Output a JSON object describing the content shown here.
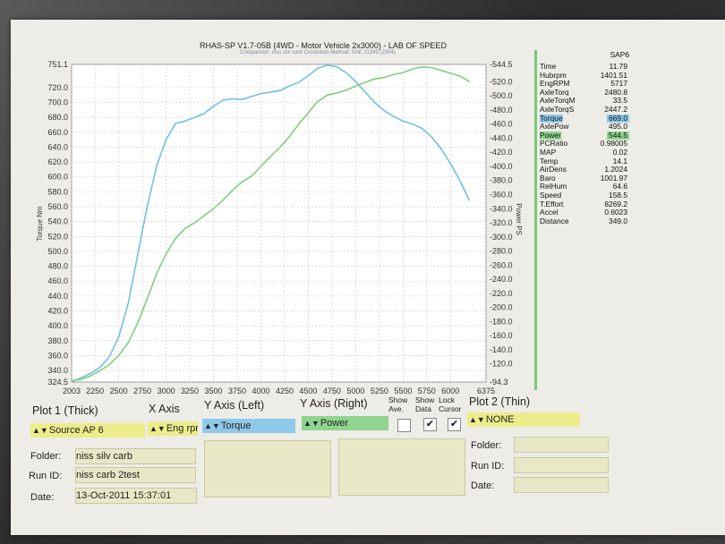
{
  "report": {
    "title": "RHAS-SP V1.7-05B  (4WD - Motor Vehicle 2x3000) - LAB OF SPEED",
    "subtitle": "Comparison: niss silv carb    Correction-Method: SAE J1349 (2004)"
  },
  "colors": {
    "torque": "#6fc0e4",
    "power": "#7fcf7f",
    "field_yellow": "#ecec8a"
  },
  "chart_data": {
    "type": "line",
    "xlabel": "",
    "ylabel_left": "Torque Nm",
    "ylabel_right": "Power PS",
    "xlim": [
      2003,
      6375
    ],
    "ylim_left": [
      324.5,
      751.1
    ],
    "ylim_right": [
      94.3,
      544.5
    ],
    "grid": true,
    "x_ticks": [
      2003,
      2250,
      2500,
      2750,
      3000,
      3250,
      3500,
      3750,
      4000,
      4250,
      4500,
      4750,
      5000,
      5250,
      5500,
      5750,
      6000,
      6375
    ],
    "y_left_ticks": [
      324.5,
      340.0,
      360.0,
      380.0,
      400.0,
      420.0,
      440.0,
      460.0,
      480.0,
      500.0,
      520.0,
      540.0,
      560.0,
      580.0,
      600.0,
      620.0,
      640.0,
      660.0,
      680.0,
      700.0,
      720.0,
      751.1
    ],
    "y_right_ticks": [
      94.3,
      120.0,
      140.0,
      160.0,
      180.0,
      200.0,
      220.0,
      240.0,
      260.0,
      280.0,
      300.0,
      320.0,
      340.0,
      360.0,
      380.0,
      400.0,
      420.0,
      440.0,
      460.0,
      480.0,
      500.0,
      520.0,
      544.5
    ],
    "series": [
      {
        "name": "Torque",
        "axis": "left",
        "x": [
          2003,
          2100,
          2200,
          2300,
          2400,
          2500,
          2600,
          2700,
          2800,
          2900,
          3000,
          3100,
          3200,
          3300,
          3400,
          3500,
          3600,
          3700,
          3800,
          3900,
          4000,
          4100,
          4200,
          4300,
          4400,
          4500,
          4600,
          4700,
          4800,
          4900,
          5000,
          5100,
          5200,
          5300,
          5400,
          5500,
          5600,
          5700,
          5800,
          5900,
          6000,
          6100,
          6200
        ],
        "values": [
          325,
          330,
          336,
          344,
          358,
          385,
          430,
          495,
          560,
          615,
          650,
          672,
          675,
          680,
          685,
          695,
          703,
          705,
          704,
          708,
          712,
          714,
          716,
          722,
          727,
          736,
          746,
          750,
          748,
          740,
          728,
          714,
          700,
          689,
          681,
          675,
          671,
          665,
          654,
          638,
          618,
          595,
          568
        ]
      },
      {
        "name": "Power",
        "axis": "right",
        "x": [
          2003,
          2100,
          2200,
          2300,
          2400,
          2500,
          2600,
          2700,
          2800,
          2900,
          3000,
          3100,
          3200,
          3300,
          3400,
          3500,
          3600,
          3700,
          3800,
          3900,
          4000,
          4100,
          4200,
          4300,
          4400,
          4500,
          4600,
          4700,
          4800,
          4900,
          5000,
          5100,
          5200,
          5300,
          5400,
          5500,
          5600,
          5700,
          5800,
          5900,
          6000,
          6100,
          6200
        ],
        "values": [
          96,
          98,
          103,
          110,
          119,
          132,
          150,
          178,
          212,
          248,
          276,
          298,
          312,
          320,
          330,
          340,
          352,
          366,
          378,
          386,
          400,
          414,
          427,
          442,
          460,
          476,
          492,
          501,
          504,
          508,
          514,
          519,
          524,
          526,
          530,
          533,
          538,
          541,
          540,
          536,
          532,
          528,
          520
        ]
      }
    ]
  },
  "readout": {
    "header": "SAP6",
    "rows": [
      {
        "label": "Time",
        "value": "11.79"
      },
      {
        "label": "Hubrpm",
        "value": "1401.51"
      },
      {
        "label": "EngRPM",
        "value": "5717"
      },
      {
        "label": "AxleTorq",
        "value": "2480.8"
      },
      {
        "label": "AxleTorqM",
        "value": "33.5"
      },
      {
        "label": "AxleTorqS",
        "value": "2447.2"
      },
      {
        "label": "Torque",
        "value": "669.0"
      },
      {
        "label": "AxlePow",
        "value": "495.0"
      },
      {
        "label": "Power",
        "value": "544.5"
      },
      {
        "label": "PCRatio",
        "value": "0.98005"
      },
      {
        "label": "MAP",
        "value": "0.02"
      },
      {
        "label": "Temp",
        "value": "14.1"
      },
      {
        "label": "AirDens",
        "value": "1.2024"
      },
      {
        "label": "Baro",
        "value": "1001.97"
      },
      {
        "label": "RelHum",
        "value": "64.6"
      },
      {
        "label": "Speed",
        "value": "158.5"
      },
      {
        "label": "T.Effort",
        "value": "8269.2"
      },
      {
        "label": "Accel",
        "value": "0.6023"
      },
      {
        "label": "Distance",
        "value": "349.0"
      }
    ]
  },
  "controls": {
    "plot1_label": "Plot 1 (Thick)",
    "xaxis_label": "X Axis",
    "yleft_label": "Y Axis (Left)",
    "yright_label": "Y Axis (Right)",
    "show_ave_label": "Show Ave.",
    "show_data_label": "Show Data",
    "lock_cursor_label": "Lock Cursor",
    "plot2_label": "Plot 2 (Thin)",
    "arrow": "▲▼",
    "check": "✔",
    "plot1_source": "Source AP 6",
    "xaxis_value": "Eng rpr",
    "yleft_value": "Torque",
    "yright_value": "Power",
    "plot2_value": "NONE",
    "folder_label": "Folder:",
    "runid_label": "Run ID:",
    "date_label": "Date:",
    "plot1_folder": "niss silv carb",
    "plot1_runid": "niss carb 2test",
    "plot1_date": "13-Oct-2011  15:37:01",
    "plot2_folder": "",
    "plot2_runid": "",
    "plot2_date": ""
  }
}
